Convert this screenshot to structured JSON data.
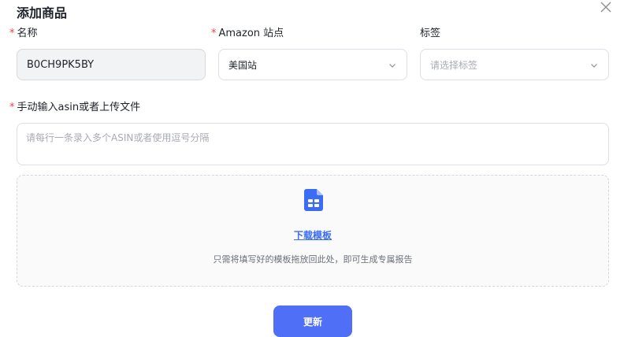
{
  "dialog": {
    "title": "添加商品"
  },
  "form": {
    "name": {
      "label": "名称",
      "value": "B0CH9PK5BY"
    },
    "site": {
      "label": "Amazon 站点",
      "value": "美国站"
    },
    "tags": {
      "label": "标签",
      "placeholder": "请选择标签"
    },
    "asin": {
      "label": "手动输入asin或者上传文件",
      "placeholder": "请每行一条录入多个ASIN或者使用逗号分隔"
    },
    "required_mark": "*"
  },
  "upload": {
    "download_label": "下载模板",
    "hint": "只需将填写好的模板拖放回此处，即可生成专属报告"
  },
  "actions": {
    "submit_label": "更新"
  },
  "colors": {
    "accent": "#4f6ff7",
    "link": "#3b6cf6",
    "required": "#f53f3f"
  },
  "icons": {
    "close": "close-icon",
    "chevron": "chevron-down-icon",
    "file": "file-template-icon"
  }
}
